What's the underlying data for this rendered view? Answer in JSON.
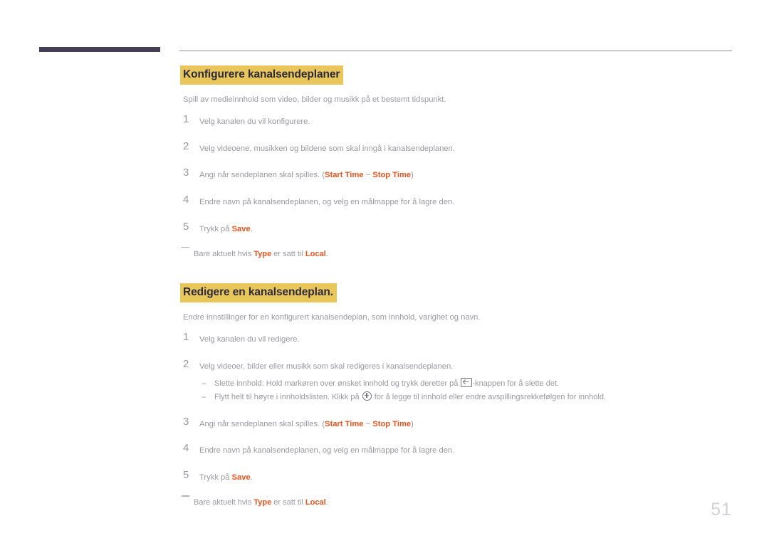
{
  "page": {
    "number": "51"
  },
  "sections": [
    {
      "heading": "Konfigurere kanalsendeplaner",
      "intro": "Spill av medieinnhold som video, bilder og musikk på et bestemt tidspunkt.",
      "steps": [
        {
          "num": "1",
          "pre": "Velg kanalen du vil konfigurere.",
          "accent1": "",
          "mid": "",
          "accent2": "",
          "post": ""
        },
        {
          "num": "2",
          "pre": "Velg videoene, musikken og bildene som skal inngå i kanalsendeplanen.",
          "accent1": "",
          "mid": "",
          "accent2": "",
          "post": ""
        },
        {
          "num": "3",
          "pre": "Angi når sendeplanen skal spilles. (",
          "accent1": "Start Time",
          "mid": " ~ ",
          "accent2": "Stop Time",
          "post": ")"
        },
        {
          "num": "4",
          "pre": "Endre navn på kanalsendeplanen, og velg en målmappe for å lagre den.",
          "accent1": "",
          "mid": "",
          "accent2": "",
          "post": ""
        },
        {
          "num": "5",
          "pre": "Trykk på ",
          "accent1": "Save",
          "mid": "",
          "accent2": "",
          "post": "."
        }
      ],
      "footnote": {
        "pre": "Bare aktuelt hvis ",
        "accent1": "Type",
        "mid": " er satt til ",
        "accent2": "Local",
        "post": "."
      }
    },
    {
      "heading": "Redigere en kanalsendeplan.",
      "intro": "Endre innstillinger for en konfigurert kanalsendeplan, som innhold, varighet og navn.",
      "steps": [
        {
          "num": "1",
          "pre": "Velg kanalen du vil redigere.",
          "accent1": "",
          "mid": "",
          "accent2": "",
          "post": ""
        },
        {
          "num": "2",
          "pre": "Velg videoer, bilder eller musikk som skal redigeres i kanalsendeplanen.",
          "accent1": "",
          "mid": "",
          "accent2": "",
          "post": ""
        },
        {
          "num": "3",
          "pre": "Angi når sendeplanen skal spilles. (",
          "accent1": "Start Time",
          "mid": " ~ ",
          "accent2": "Stop Time",
          "post": ")"
        },
        {
          "num": "4",
          "pre": "Endre navn på kanalsendeplanen, og velg en målmappe for å lagre den.",
          "accent1": "",
          "mid": "",
          "accent2": "",
          "post": ""
        },
        {
          "num": "5",
          "pre": "Trykk på ",
          "accent1": "Save",
          "mid": "",
          "accent2": "",
          "post": "."
        }
      ],
      "subbullets": [
        {
          "dash": "–",
          "pre": "Slette innhold: Hold markøren over ønsket innhold og trykk deretter på ",
          "icon": "delete-key-icon",
          "post": "-knappen for å slette det."
        },
        {
          "dash": "–",
          "pre": "Flytt helt til høyre i innholdslisten. Klikk på ",
          "icon": "circle-plus-icon",
          "post": " for å legge til innhold eller endre avspillingsrekkefølgen for innhold."
        }
      ],
      "footnote": {
        "pre": "Bare aktuelt hvis ",
        "accent1": "Type",
        "mid": " er satt til ",
        "accent2": "Local",
        "post": "."
      }
    }
  ],
  "colors": {
    "highlight": "#e8c65a",
    "heading_text": "#2d2a3e",
    "accent": "#e8541f",
    "body_text": "#9a9a9e",
    "header_bar": "#463e55",
    "page_number": "#d2d2d6"
  }
}
